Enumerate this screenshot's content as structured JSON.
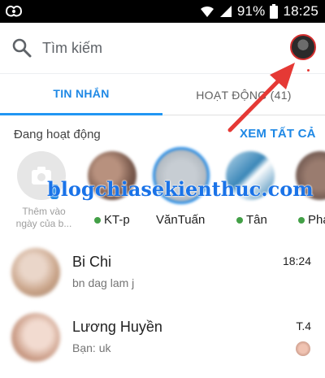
{
  "status_bar": {
    "battery_text": "91%",
    "time": "18:25",
    "icons": [
      "notification-app-icon",
      "wifi-icon",
      "signal-icon",
      "battery-icon"
    ]
  },
  "search": {
    "placeholder": "Tìm kiếm",
    "icon": "search-icon"
  },
  "tabs": [
    {
      "label": "TIN NHẮN",
      "active": true
    },
    {
      "label": "HOẠT ĐỘNG (41)",
      "active": false
    }
  ],
  "active_section": {
    "title": "Đang hoạt động",
    "see_all": "XEM TẤT CẢ",
    "add_story_caption_line1": "Thêm vào",
    "add_story_caption_line2": "ngày của b...",
    "friends": [
      {
        "name": "KT-p",
        "online": true
      },
      {
        "name": "VănTuấn",
        "online": false
      },
      {
        "name": "Tân",
        "online": true
      },
      {
        "name": "Pha",
        "online": true
      }
    ]
  },
  "watermark": "blogchiasekienthuc.com",
  "conversations": [
    {
      "name": "Bi Chi",
      "preview": "bn dag lam j",
      "time": "18:24"
    },
    {
      "name": "Lương Huyền",
      "preview": "Bạn: uk",
      "time": "T.4"
    }
  ],
  "colors": {
    "accent": "#1e88e5",
    "online": "#43a047",
    "annotation_arrow": "#e53935"
  }
}
